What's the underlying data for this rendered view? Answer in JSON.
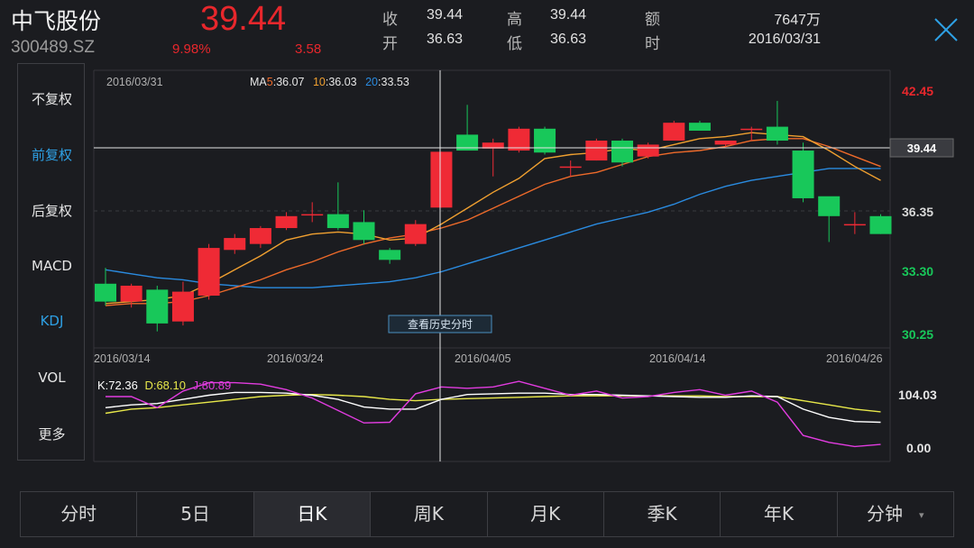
{
  "stock": {
    "name": "中飞股份",
    "code": "300489.SZ",
    "price": "39.44",
    "change_pct": "9.98%",
    "change": "3.58",
    "price_color": "#e8272c"
  },
  "quote": {
    "close_label": "收",
    "close_value": "39.44",
    "high_label": "高",
    "high_value": "39.44",
    "amount_label": "额",
    "amount_value": "7647万",
    "open_label": "开",
    "open_value": "36.63",
    "low_label": "低",
    "low_value": "36.63",
    "time_label": "时",
    "time_value": "2016/03/31"
  },
  "close_icon": "close-x-icon",
  "sidebar": {
    "items": [
      {
        "label": "不复权",
        "active": false
      },
      {
        "label": "前复权",
        "active": true
      },
      {
        "label": "后复权",
        "active": false
      },
      {
        "label": "MACD",
        "active": false
      },
      {
        "label": "KDJ",
        "active": true
      },
      {
        "label": "VOL",
        "active": false
      },
      {
        "label": "更多",
        "active": false
      }
    ]
  },
  "chart_data": {
    "type": "candlestick",
    "date_label": "2016/03/31",
    "ma": {
      "prefix": "MA",
      "ma5_period": "5",
      "ma5_value": "36.07",
      "ma10_period": "10",
      "ma10_value": "36.03",
      "ma20_period": "20",
      "ma20_value": "33.53"
    },
    "ma_colors": {
      "ma5": "#f0a030",
      "ma10": "#ee6a2a",
      "ma20": "#2a8be0"
    },
    "up_color": "#ef2a35",
    "down_color": "#18c85a",
    "y_ticks": [
      "42.45",
      "36.35",
      "33.30",
      "30.25"
    ],
    "y_tick_colors": [
      "#e8272c",
      "#d8d8d8",
      "#18c85a",
      "#18c85a"
    ],
    "ylim": [
      30.25,
      42.45
    ],
    "crosshair_price": "39.44",
    "crosshair_index": 13,
    "history_button": "查看历史分时",
    "x_date_labels": [
      "2016/03/14",
      "2016/03/24",
      "2016/04/05",
      "2016/04/14",
      "2016/04/26"
    ],
    "candles": [
      {
        "o": 32.8,
        "c": 31.9,
        "h": 33.6,
        "l": 31.7
      },
      {
        "o": 31.9,
        "c": 32.7,
        "h": 32.8,
        "l": 31.6
      },
      {
        "o": 32.5,
        "c": 30.8,
        "h": 32.7,
        "l": 30.4
      },
      {
        "o": 30.9,
        "c": 32.4,
        "h": 32.9,
        "l": 30.7
      },
      {
        "o": 32.2,
        "c": 34.6,
        "h": 34.8,
        "l": 32.0
      },
      {
        "o": 34.5,
        "c": 35.1,
        "h": 35.3,
        "l": 34.3
      },
      {
        "o": 34.8,
        "c": 35.6,
        "h": 35.7,
        "l": 34.6
      },
      {
        "o": 35.6,
        "c": 36.2,
        "h": 36.4,
        "l": 35.5
      },
      {
        "o": 36.3,
        "c": 36.3,
        "h": 36.9,
        "l": 35.9
      },
      {
        "o": 36.3,
        "c": 35.6,
        "h": 37.9,
        "l": 35.5
      },
      {
        "o": 35.9,
        "c": 35.0,
        "h": 36.5,
        "l": 34.8
      },
      {
        "o": 34.5,
        "c": 34.0,
        "h": 34.6,
        "l": 33.8
      },
      {
        "o": 34.8,
        "c": 35.8,
        "h": 36.0,
        "l": 34.7
      },
      {
        "o": 36.63,
        "c": 39.44,
        "h": 39.44,
        "l": 36.63
      },
      {
        "o": 40.3,
        "c": 39.5,
        "h": 41.8,
        "l": 39.5
      },
      {
        "o": 39.6,
        "c": 39.9,
        "h": 40.1,
        "l": 38.2
      },
      {
        "o": 39.5,
        "c": 40.6,
        "h": 40.7,
        "l": 39.4
      },
      {
        "o": 40.6,
        "c": 39.4,
        "h": 40.7,
        "l": 39.3
      },
      {
        "o": 38.7,
        "c": 38.7,
        "h": 39.0,
        "l": 38.2
      },
      {
        "o": 39.0,
        "c": 40.0,
        "h": 40.1,
        "l": 39.0
      },
      {
        "o": 40.0,
        "c": 38.9,
        "h": 40.1,
        "l": 38.7
      },
      {
        "o": 39.2,
        "c": 39.8,
        "h": 39.9,
        "l": 39.1
      },
      {
        "o": 40.0,
        "c": 40.9,
        "h": 41.0,
        "l": 40.0
      },
      {
        "o": 40.9,
        "c": 40.5,
        "h": 41.0,
        "l": 40.5
      },
      {
        "o": 39.8,
        "c": 40.0,
        "h": 40.0,
        "l": 39.7
      },
      {
        "o": 40.6,
        "c": 40.6,
        "h": 40.7,
        "l": 40.0
      },
      {
        "o": 40.7,
        "c": 40.0,
        "h": 42.0,
        "l": 39.8
      },
      {
        "o": 39.5,
        "c": 37.1,
        "h": 39.9,
        "l": 36.9
      },
      {
        "o": 37.2,
        "c": 36.2,
        "h": 36.7,
        "l": 34.9
      },
      {
        "o": 35.8,
        "c": 35.8,
        "h": 36.4,
        "l": 35.3
      },
      {
        "o": 36.2,
        "c": 35.3,
        "h": 36.3,
        "l": 35.3
      }
    ],
    "ma5": [
      31.8,
      31.9,
      32.0,
      32.2,
      32.8,
      33.5,
      34.2,
      35.0,
      35.3,
      35.4,
      35.3,
      35.0,
      35.1,
      35.8,
      36.6,
      37.4,
      38.1,
      39.1,
      39.3,
      39.4,
      39.6,
      39.5,
      39.8,
      40.1,
      40.2,
      40.4,
      40.3,
      40.2,
      39.5,
      38.7,
      38.0
    ],
    "ma10": [
      31.7,
      31.8,
      31.8,
      31.9,
      32.2,
      32.6,
      33.0,
      33.5,
      33.9,
      34.4,
      34.8,
      35.1,
      35.3,
      35.6,
      36.0,
      36.6,
      37.2,
      37.8,
      38.2,
      38.4,
      38.8,
      39.2,
      39.4,
      39.5,
      39.7,
      40.0,
      40.1,
      40.1,
      39.7,
      39.2,
      38.7
    ],
    "ma20": [
      33.5,
      33.3,
      33.1,
      33.0,
      32.8,
      32.7,
      32.6,
      32.6,
      32.6,
      32.7,
      32.8,
      32.9,
      33.1,
      33.4,
      33.8,
      34.2,
      34.6,
      35.0,
      35.4,
      35.8,
      36.1,
      36.4,
      36.8,
      37.3,
      37.7,
      38.0,
      38.2,
      38.4,
      38.6,
      38.6,
      38.6
    ],
    "kdj": {
      "k_label": "K:72.36",
      "d_label": "D:68.10",
      "j_label": "J:80.89",
      "k_color": "#ffffff",
      "d_color": "#e8e84a",
      "j_color": "#e23ce0",
      "y_ticks": [
        "104.03",
        "0.00"
      ],
      "ylim": [
        0,
        104.03
      ],
      "K": [
        62,
        66,
        68,
        74,
        80,
        84,
        84,
        83,
        80,
        74,
        63,
        60,
        60,
        74,
        81,
        82,
        83,
        83,
        81,
        81,
        80,
        79,
        78,
        77,
        77,
        79,
        78,
        60,
        48,
        42,
        41
      ],
      "D": [
        54,
        60,
        62,
        66,
        70,
        74,
        78,
        80,
        81,
        80,
        78,
        74,
        72,
        74,
        75,
        76,
        77,
        78,
        79,
        79,
        79,
        79,
        79,
        79,
        78,
        78,
        78,
        72,
        66,
        60,
        56
      ],
      "J": [
        78,
        78,
        62,
        86,
        98,
        98,
        96,
        88,
        76,
        58,
        40,
        41,
        82,
        92,
        90,
        92,
        100,
        90,
        80,
        86,
        76,
        78,
        84,
        88,
        80,
        86,
        70,
        22,
        12,
        6,
        9
      ]
    }
  },
  "bottom_tabs": [
    {
      "label": "分时",
      "active": false
    },
    {
      "label": "5日",
      "active": false
    },
    {
      "label": "日K",
      "active": true
    },
    {
      "label": "周K",
      "active": false
    },
    {
      "label": "月K",
      "active": false
    },
    {
      "label": "季K",
      "active": false
    },
    {
      "label": "年K",
      "active": false
    },
    {
      "label": "分钟",
      "active": false,
      "caret": "▾"
    }
  ]
}
